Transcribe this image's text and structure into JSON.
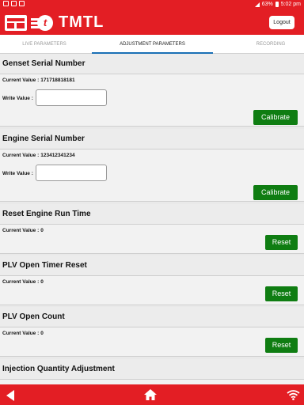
{
  "status_bar": {
    "battery": "63%",
    "time": "5:02 pm"
  },
  "header": {
    "brand": "TMTL",
    "logout_label": "Logout"
  },
  "tabs": [
    {
      "label": "LIVE PARAMETERS",
      "active": false
    },
    {
      "label": "ADJUSTMENT PARAMETERS",
      "active": true
    },
    {
      "label": "RECORDING",
      "active": false
    }
  ],
  "sections": {
    "genset": {
      "title": "Genset Serial Number",
      "current_label": "Current Value :",
      "current_value": "171718818181",
      "write_label": "Write Value :",
      "write_value": "",
      "button_label": "Calibrate"
    },
    "engine": {
      "title": "Engine Serial Number",
      "current_label": "Current Value :",
      "current_value": "123412341234",
      "write_label": "Write Value :",
      "write_value": "",
      "button_label": "Calibrate"
    },
    "run_time": {
      "title": "Reset Engine Run Time",
      "current_label": "Current Value :",
      "current_value": "0",
      "button_label": "Reset"
    },
    "plv_timer": {
      "title": "PLV Open Timer Reset",
      "current_label": "Current Value :",
      "current_value": "0",
      "button_label": "Reset"
    },
    "plv_count": {
      "title": "PLV Open Count",
      "current_label": "Current Value :",
      "current_value": "0",
      "button_label": "Reset"
    },
    "injection": {
      "title": "Injection Quantity Adjustment"
    }
  },
  "colors": {
    "brand_red": "#e31e24",
    "button_green": "#0f7d12",
    "tab_indicator": "#1a6fb5"
  },
  "icons": {
    "nav_back": "back-triangle-icon",
    "nav_home": "home-icon",
    "nav_wifi": "wifi-icon"
  }
}
